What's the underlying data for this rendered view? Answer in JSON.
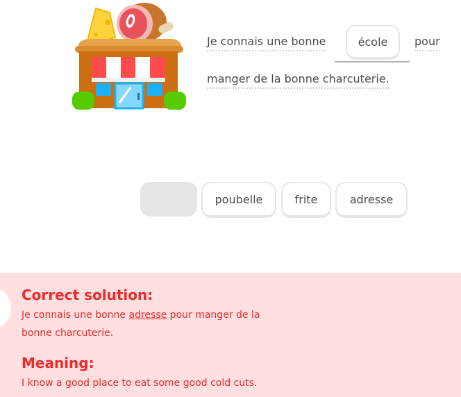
{
  "challenge": {
    "sentence_start": "Je connais une bonne",
    "selected_word": "école",
    "sentence_mid": "pour",
    "sentence_end": "manger de la bonne charcuterie."
  },
  "word_bank": {
    "tiles": [
      "poubelle",
      "frite",
      "adresse"
    ]
  },
  "feedback": {
    "solution_heading": "Correct solution:",
    "solution_before": "Je connais une bonne ",
    "solution_answer": "adresse",
    "solution_after": " pour manger de la bonne charcuterie.",
    "meaning_heading": "Meaning:",
    "meaning_text": "I know a good place to eat some good cold cuts."
  },
  "colors": {
    "feedback_bg": "#ffdfe0",
    "feedback_text": "#ea2b2b",
    "tile_border": "#e5e5e5"
  }
}
